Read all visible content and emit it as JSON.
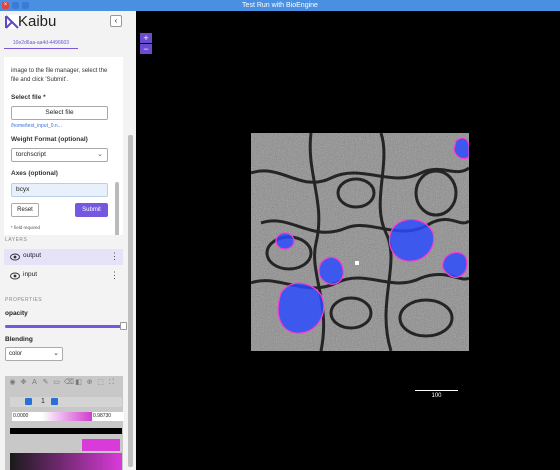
{
  "window": {
    "title": "Test Run with BioEngine"
  },
  "app": {
    "name": "Kaibu",
    "collapse_label": "‹"
  },
  "session": {
    "tab_label": "10e2d6aa-aa4d-4496603"
  },
  "form": {
    "instructions": "image to the file manager, select the file and click 'Submit'.",
    "select_file_label": "Select file *",
    "select_file_button": "Select file",
    "file_path": "/home/test_input_0.n...",
    "weight_format_label": "Weight Format (optional)",
    "weight_format_value": "torchscript",
    "axes_label": "Axes (optional)",
    "axes_value": "bcyx",
    "reset_label": "Reset",
    "submit_label": "Submit",
    "required_note": "* field required"
  },
  "layers": {
    "header": "LAYERS",
    "items": [
      {
        "name": "output",
        "selected": true
      },
      {
        "name": "input",
        "selected": false
      }
    ]
  },
  "properties": {
    "header": "PROPERTIES",
    "opacity_label": "opacity",
    "opacity_value": 1.0,
    "blending_label": "Blending",
    "blending_value": "color"
  },
  "channel": {
    "number": "1",
    "range_min": "0.0000",
    "range_max": "0.98730",
    "color": "#d93bd9"
  },
  "viewer": {
    "zoom_in_label": "+",
    "zoom_out_label": "−",
    "scalebar_label": "100"
  },
  "colors": {
    "accent": "#7557e0",
    "titlebar": "#4a90e2",
    "mitochondria_overlay": "#2a4bff"
  }
}
